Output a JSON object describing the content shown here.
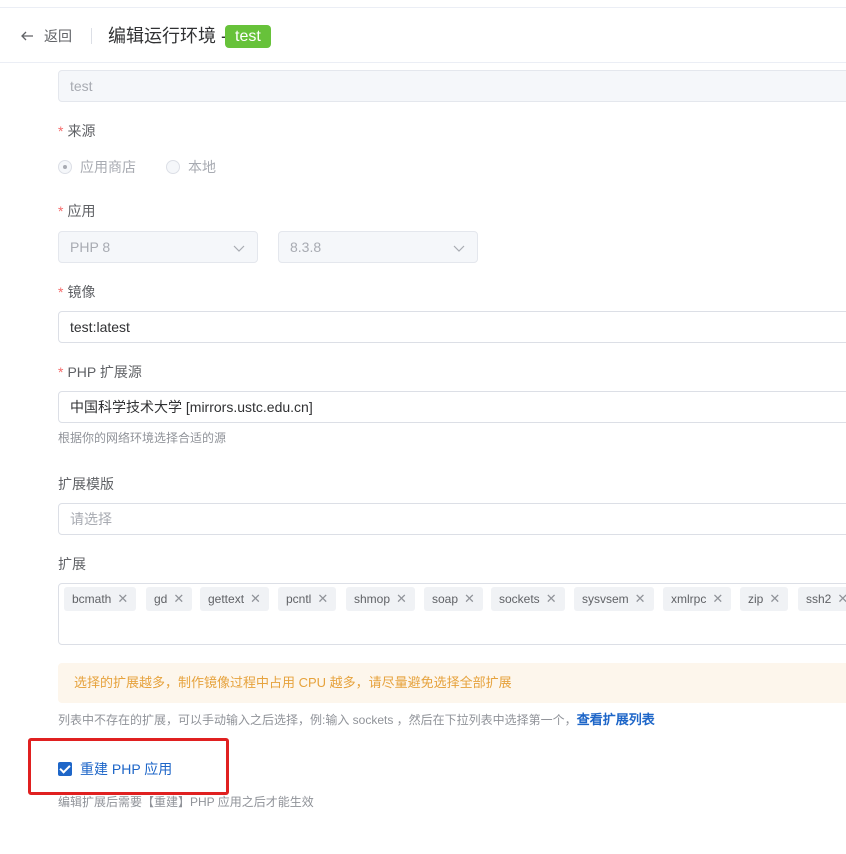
{
  "header": {
    "back_label": "返回",
    "title": "编辑运行环境 -",
    "tag": "test",
    "tag_color": "#67c23a"
  },
  "form": {
    "name_value": "test",
    "source": {
      "label": "来源",
      "options": [
        "应用商店",
        "本地"
      ],
      "selected": "应用商店"
    },
    "app": {
      "label": "应用",
      "app_value": "PHP 8",
      "version_value": "8.3.8"
    },
    "image": {
      "label": "镜像",
      "value": "test:latest"
    },
    "ext_source": {
      "label": "PHP 扩展源",
      "value": "中国科学技术大学 [mirrors.ustc.edu.cn]",
      "hint": "根据你的网络环境选择合适的源"
    },
    "ext_template": {
      "label": "扩展模版",
      "placeholder": "请选择"
    },
    "extensions": {
      "label": "扩展",
      "items": [
        "bcmath",
        "gd",
        "gettext",
        "pcntl",
        "shmop",
        "soap",
        "sockets",
        "sysvsem",
        "xmlrpc",
        "zip",
        "ssh2"
      ],
      "warning": "选择的扩展越多，制作镜像过程中占用 CPU 越多，请尽量避免选择全部扩展",
      "hint": "列表中不存在的扩展，可以手动输入之后选择，例:输入 sockets ，然后在下拉列表中选择第一个，",
      "link": "查看扩展列表"
    },
    "rebuild": {
      "label": "重建 PHP 应用",
      "checked": true,
      "hint": "编辑扩展后需要【重建】PHP 应用之后才能生效"
    }
  },
  "colors": {
    "primary": "#1e66c8",
    "required": "#f56c6c",
    "warning_text": "#e6a23c",
    "warning_bg": "#fdf6ec",
    "highlight": "#e02020"
  }
}
